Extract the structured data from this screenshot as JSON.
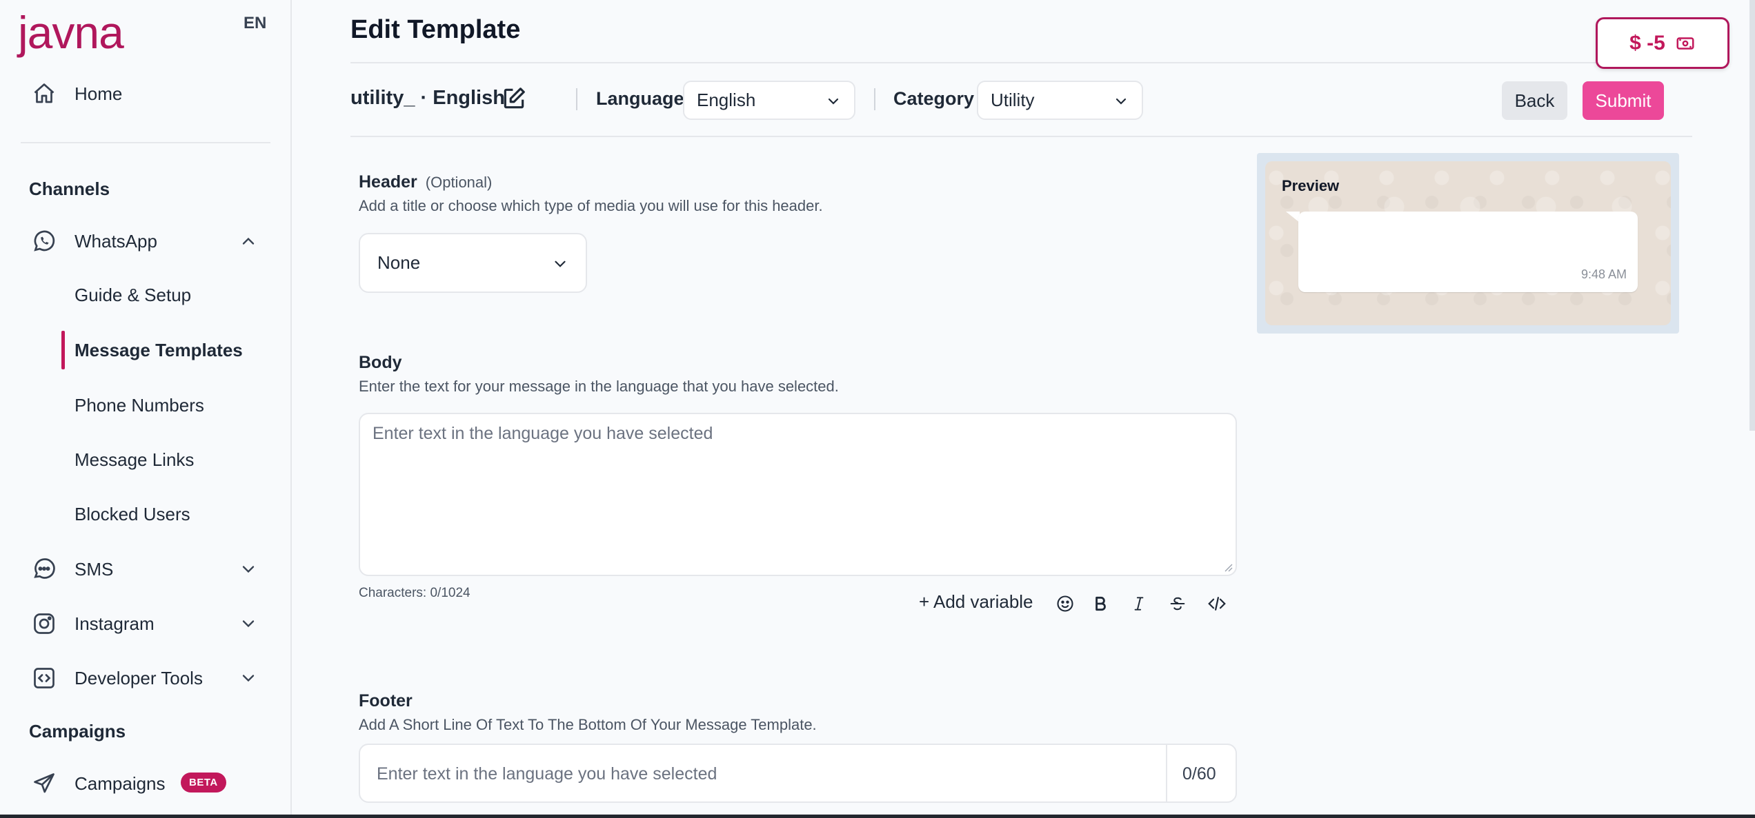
{
  "brand": {
    "logo_text": "javna",
    "language_code": "EN",
    "accent": "#c2185b"
  },
  "sidebar": {
    "home": "Home",
    "channels_title": "Channels",
    "whatsapp": "WhatsApp",
    "whatsapp_items": [
      "Guide & Setup",
      "Message Templates",
      "Phone Numbers",
      "Message Links",
      "Blocked Users"
    ],
    "active_item": "Message Templates",
    "sms": "SMS",
    "instagram": "Instagram",
    "developer_tools": "Developer Tools",
    "campaigns_title": "Campaigns",
    "campaigns": "Campaigns",
    "beta_badge": "BETA"
  },
  "page": {
    "title": "Edit Template",
    "balance": "$ -5"
  },
  "template_bar": {
    "name": "utility_ · English",
    "language_label": "Language",
    "language_value": "English",
    "category_label": "Category",
    "category_value": "Utility",
    "back": "Back",
    "submit": "Submit"
  },
  "header_section": {
    "title": "Header",
    "optional": "(Optional)",
    "description": "Add a title or choose which type of media you will use for this header.",
    "select_value": "None"
  },
  "body_section": {
    "title": "Body",
    "description": "Enter the text for your message in the language that you have selected.",
    "placeholder": "Enter text in the language you have selected",
    "char_count": "Characters: 0/1024",
    "add_variable": "+ Add variable"
  },
  "footer_section": {
    "title": "Footer",
    "description": "Add A Short Line Of Text To The Bottom Of Your Message Template.",
    "placeholder": "Enter text in the language you have selected",
    "count": "0/60"
  },
  "preview": {
    "label": "Preview",
    "time": "9:48 AM"
  },
  "icons": [
    "home-icon",
    "whatsapp-icon",
    "chevron-up-icon",
    "chat-icon",
    "chevron-down-icon",
    "instagram-icon",
    "code-icon",
    "send-icon",
    "edit-icon",
    "wallet-icon",
    "emoji-icon",
    "bold-icon",
    "italic-icon",
    "strikethrough-icon"
  ]
}
